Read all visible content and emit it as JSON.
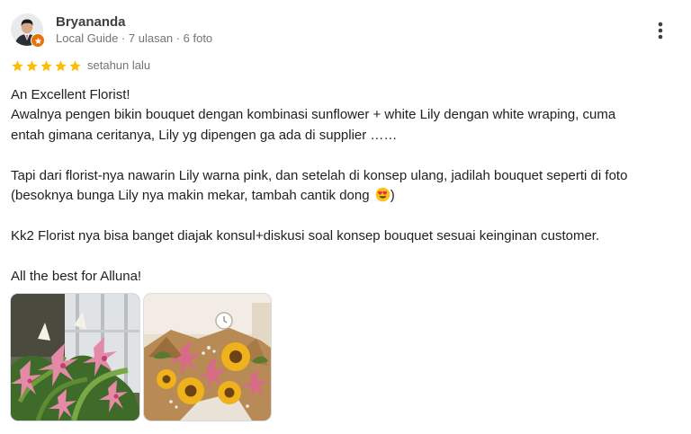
{
  "review": {
    "author": {
      "name": "Bryananda",
      "meta": "Local Guide · 7 ulasan · 6 foto",
      "avatar_icon": "user-avatar",
      "badge_icon": "local-guide-star-icon",
      "badge_color": "#e8710a"
    },
    "rating": 5,
    "star_color": "#fbbc04",
    "time": "setahun lalu",
    "lines": [
      "An Excellent Florist!",
      "Awalnya pengen bikin bouquet dengan kombinasi sunflower + white Lily dengan white wraping, cuma",
      "entah gimana ceritanya, Lily yg dipengen ga ada di supplier ……",
      "",
      "Tapi dari florist-nya nawarin Lily warna pink, dan setelah di konsep ulang, jadilah bouquet seperti di foto",
      "(besoknya bunga Lily nya makin mekar, tambah cantik dong",
      ")",
      "",
      "Kk2 Florist nya bisa banget diajak konsul+diskusi soal konsep bouquet sesuai keinginan customer.",
      "",
      "All the best for Alluna!"
    ],
    "emoji_icon": "heart-eyes-emoji",
    "photos": [
      {
        "subject": "pink-lily-bouquet-photo"
      },
      {
        "subject": "sunflower-lily-bouquet-photo"
      }
    ],
    "more_icon": "more-vert-icon"
  }
}
